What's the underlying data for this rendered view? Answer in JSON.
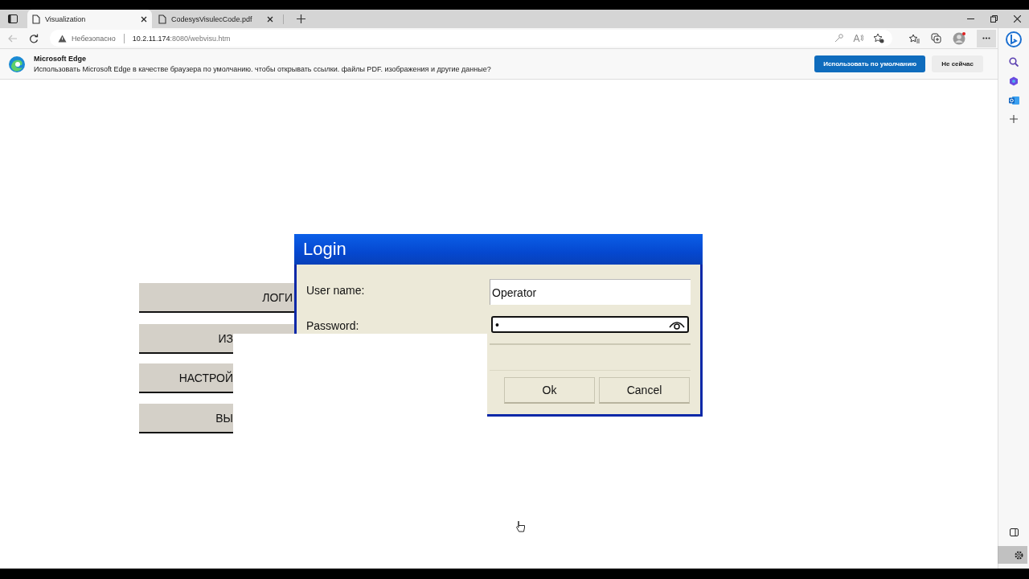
{
  "browser": {
    "tabs": [
      {
        "title": "Visualization",
        "selected": true
      },
      {
        "title": "CodesysVisulecCode.pdf",
        "selected": false
      }
    ],
    "address": {
      "security": "Небезопасно",
      "host": "10.2.11.174",
      "rest": ":8080/webvisu.htm"
    },
    "infobar": {
      "title": "Microsoft Edge",
      "message": "Использовать Microsoft Edge в качестве браузера по умолчанию. чтобы открывать ссылки. файлы PDF. изображения и другие данные?",
      "buttons": [
        {
          "label": "Использовать по умолчанию",
          "kind": "primary"
        },
        {
          "label": "Не сейчас",
          "kind": "secondary"
        }
      ]
    }
  },
  "visu": {
    "menu_buttons": [
      "ЛОГИ",
      "ИЗ",
      "НАСТРОЙ",
      "ВЫ"
    ],
    "login_dialog": {
      "title": "Login",
      "fields": [
        {
          "label": "User name:",
          "value": "Operator",
          "kind": "text",
          "focused": false
        },
        {
          "label": "Password:",
          "value": "•",
          "kind": "password",
          "focused": true
        }
      ],
      "buttons": [
        "Ok",
        "Cancel"
      ]
    }
  }
}
